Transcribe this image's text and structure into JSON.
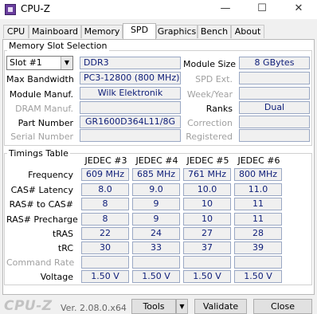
{
  "window": {
    "title": "CPU-Z",
    "minimize": "—",
    "maximize": "☐",
    "close": "✕"
  },
  "tabs": [
    "CPU",
    "Mainboard",
    "Memory",
    "SPD",
    "Graphics",
    "Bench",
    "About"
  ],
  "active_tab": "SPD",
  "slot_group": {
    "title": "Memory Slot Selection",
    "slot_selected": "Slot #1",
    "memory_type": "DDR3",
    "module_size_label": "Module Size",
    "module_size": "8 GBytes",
    "max_bandwidth_label": "Max Bandwidth",
    "max_bandwidth": "PC3-12800 (800 MHz)",
    "spd_ext_label": "SPD Ext.",
    "spd_ext": "",
    "module_manuf_label": "Module Manuf.",
    "module_manuf": "Wilk Elektronik",
    "week_year_label": "Week/Year",
    "week_year": "",
    "dram_manuf_label": "DRAM Manuf.",
    "dram_manuf": "",
    "ranks_label": "Ranks",
    "ranks": "Dual",
    "part_number_label": "Part Number",
    "part_number": "GR1600D364L11/8G",
    "correction_label": "Correction",
    "correction": "",
    "serial_number_label": "Serial Number",
    "serial_number": "",
    "registered_label": "Registered",
    "registered": ""
  },
  "timings": {
    "title": "Timings Table",
    "columns": [
      "JEDEC #3",
      "JEDEC #4",
      "JEDEC #5",
      "JEDEC #6"
    ],
    "rows": [
      {
        "label": "Frequency",
        "values": [
          "609 MHz",
          "685 MHz",
          "761 MHz",
          "800 MHz"
        ]
      },
      {
        "label": "CAS# Latency",
        "values": [
          "8.0",
          "9.0",
          "10.0",
          "11.0"
        ]
      },
      {
        "label": "RAS# to CAS#",
        "values": [
          "8",
          "9",
          "10",
          "11"
        ]
      },
      {
        "label": "RAS# Precharge",
        "values": [
          "8",
          "9",
          "10",
          "11"
        ]
      },
      {
        "label": "tRAS",
        "values": [
          "22",
          "24",
          "27",
          "28"
        ]
      },
      {
        "label": "tRC",
        "values": [
          "30",
          "33",
          "37",
          "39"
        ]
      },
      {
        "label": "Command Rate",
        "values": [
          "",
          "",
          "",
          ""
        ]
      },
      {
        "label": "Voltage",
        "values": [
          "1.50 V",
          "1.50 V",
          "1.50 V",
          "1.50 V"
        ]
      }
    ]
  },
  "footer": {
    "logo": "CPU-Z",
    "version": "Ver. 2.08.0.x64",
    "tools_label": "Tools",
    "validate_label": "Validate",
    "close_label": "Close"
  }
}
